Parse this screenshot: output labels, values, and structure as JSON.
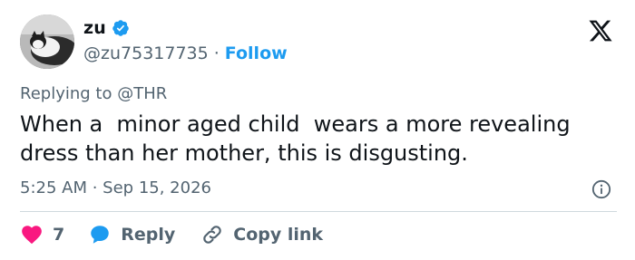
{
  "tweet": {
    "author": {
      "display_name": "zu",
      "handle": "@zu75317735",
      "separator": "·",
      "follow_label": "Follow"
    },
    "replying_prefix": "Replying to ",
    "replying_mention": "@THR",
    "text": "When a  minor aged child  wears a more revealing dress than her mother, this is disgusting.",
    "time": "5:25 AM",
    "meta_separator": " · ",
    "date": "Sep 15, 2026",
    "actions": {
      "like_count": "7",
      "reply_label": "Reply",
      "copy_link_label": "Copy link"
    }
  },
  "colors": {
    "accent": "#1d9bf0",
    "like": "#f91880",
    "text_primary": "#0f1419",
    "text_secondary": "#536471"
  },
  "icons": [
    "verified-badge-icon",
    "x-logo-icon",
    "info-icon",
    "heart-icon",
    "speech-bubble-icon",
    "link-icon"
  ]
}
